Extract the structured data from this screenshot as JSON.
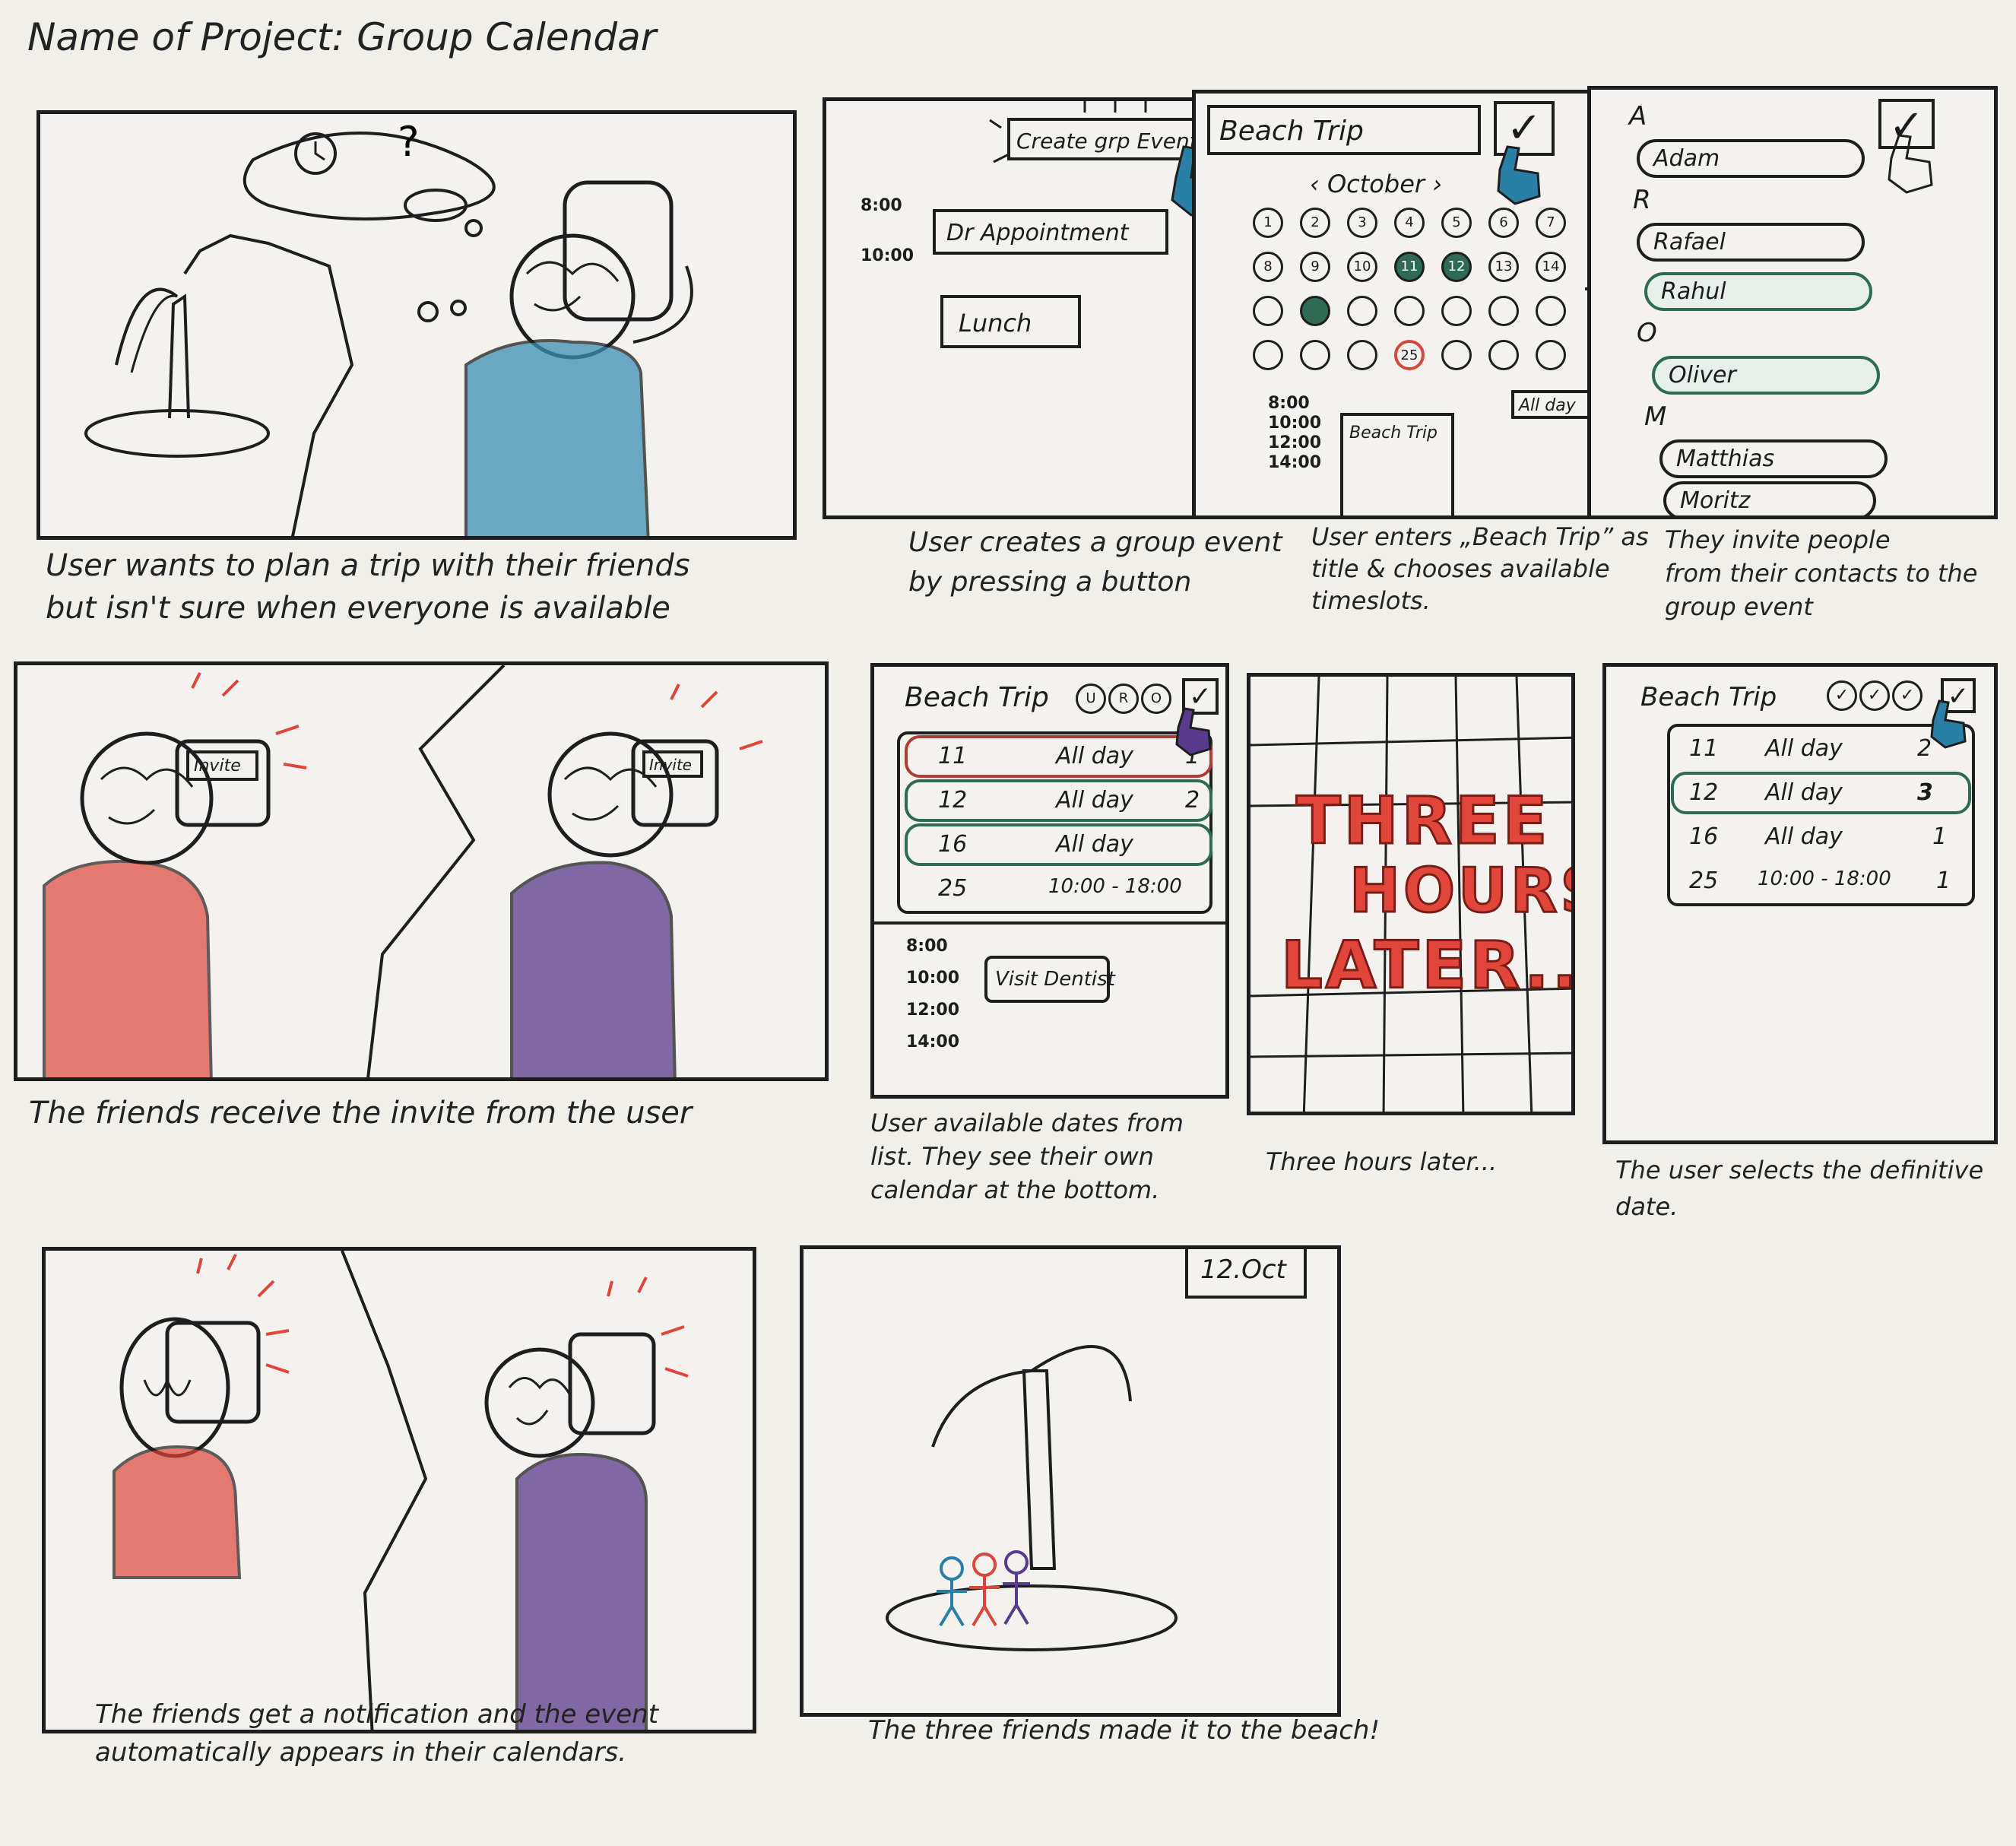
{
  "title": "Name of Project: Group Calendar",
  "captions": {
    "p1": [
      "User wants to plan a trip with their friends",
      "but isn't sure when everyone is available"
    ],
    "p2": [
      "User creates a group event",
      "by pressing a button"
    ],
    "p3": [
      "User enters „Beach Trip” as",
      "title & chooses available",
      "timeslots."
    ],
    "p4": [
      "They invite people",
      "from their contacts to the",
      "group event"
    ],
    "p5": [
      "The friends receive the invite from the user"
    ],
    "p6": [
      "User available dates from",
      "list. They see their own",
      "calendar at the bottom."
    ],
    "p7": [
      "Three hours later..."
    ],
    "p8": [
      "The user selects the definitive",
      "date."
    ],
    "p9": [
      "The friends get a notification and the event",
      "automatically appears in their calendars."
    ],
    "p10": [
      "The three friends made it to the beach!"
    ]
  },
  "panel2": {
    "create_button": "Create grp Event",
    "times": [
      "8:00",
      "10:00"
    ],
    "events": [
      "Dr Appointment",
      "Lunch"
    ]
  },
  "panel3": {
    "title_input": "Beach Trip",
    "month": "October",
    "days": [
      "1",
      "2",
      "3",
      "4",
      "5",
      "6",
      "7",
      "8",
      "9",
      "10",
      "11",
      "12",
      "13",
      "14",
      "",
      "",
      "",
      "",
      "",
      "",
      "",
      "",
      "",
      "",
      "25",
      "",
      "",
      ""
    ],
    "all_day": "All day",
    "times": [
      "8:00",
      "10:00",
      "12:00",
      "14:00"
    ],
    "event": "Beach Trip"
  },
  "panel4": {
    "groups": [
      {
        "letter": "A",
        "contacts": [
          "Adam"
        ]
      },
      {
        "letter": "R",
        "contacts": [
          "Rafael",
          "Rahul"
        ]
      },
      {
        "letter": "O",
        "contacts": [
          "Oliver"
        ]
      },
      {
        "letter": "M",
        "contacts": [
          "Matthias",
          "Moritz"
        ]
      }
    ]
  },
  "panel5": {
    "invite_label": "Invite"
  },
  "panel6": {
    "title": "Beach Trip",
    "avatars": [
      "U",
      "R",
      "O"
    ],
    "rows": [
      {
        "day": "11",
        "time": "All day",
        "count": "1"
      },
      {
        "day": "12",
        "time": "All day",
        "count": "2"
      },
      {
        "day": "16",
        "time": "All day",
        "count": ""
      },
      {
        "day": "25",
        "time": "10:00 - 18:00",
        "count": ""
      }
    ],
    "times": [
      "8:00",
      "10:00",
      "12:00",
      "14:00"
    ],
    "event": "Visit Dentist"
  },
  "panel7": {
    "words": [
      "THREE",
      "HOURS",
      "LATER..."
    ]
  },
  "panel8": {
    "title": "Beach Trip",
    "rows": [
      {
        "day": "11",
        "time": "All day",
        "count": "2"
      },
      {
        "day": "12",
        "time": "All day",
        "count": "3"
      },
      {
        "day": "16",
        "time": "All day",
        "count": "1"
      },
      {
        "day": "25",
        "time": "10:00 - 18:00",
        "count": "1"
      }
    ]
  },
  "panel10": {
    "date_tag": "12.Oct"
  },
  "colors": {
    "ink": "#1c1c1c",
    "blue": "#2a7fa6",
    "red": "#d9463b",
    "purple": "#5a3a8c",
    "green": "#2d6b55"
  }
}
